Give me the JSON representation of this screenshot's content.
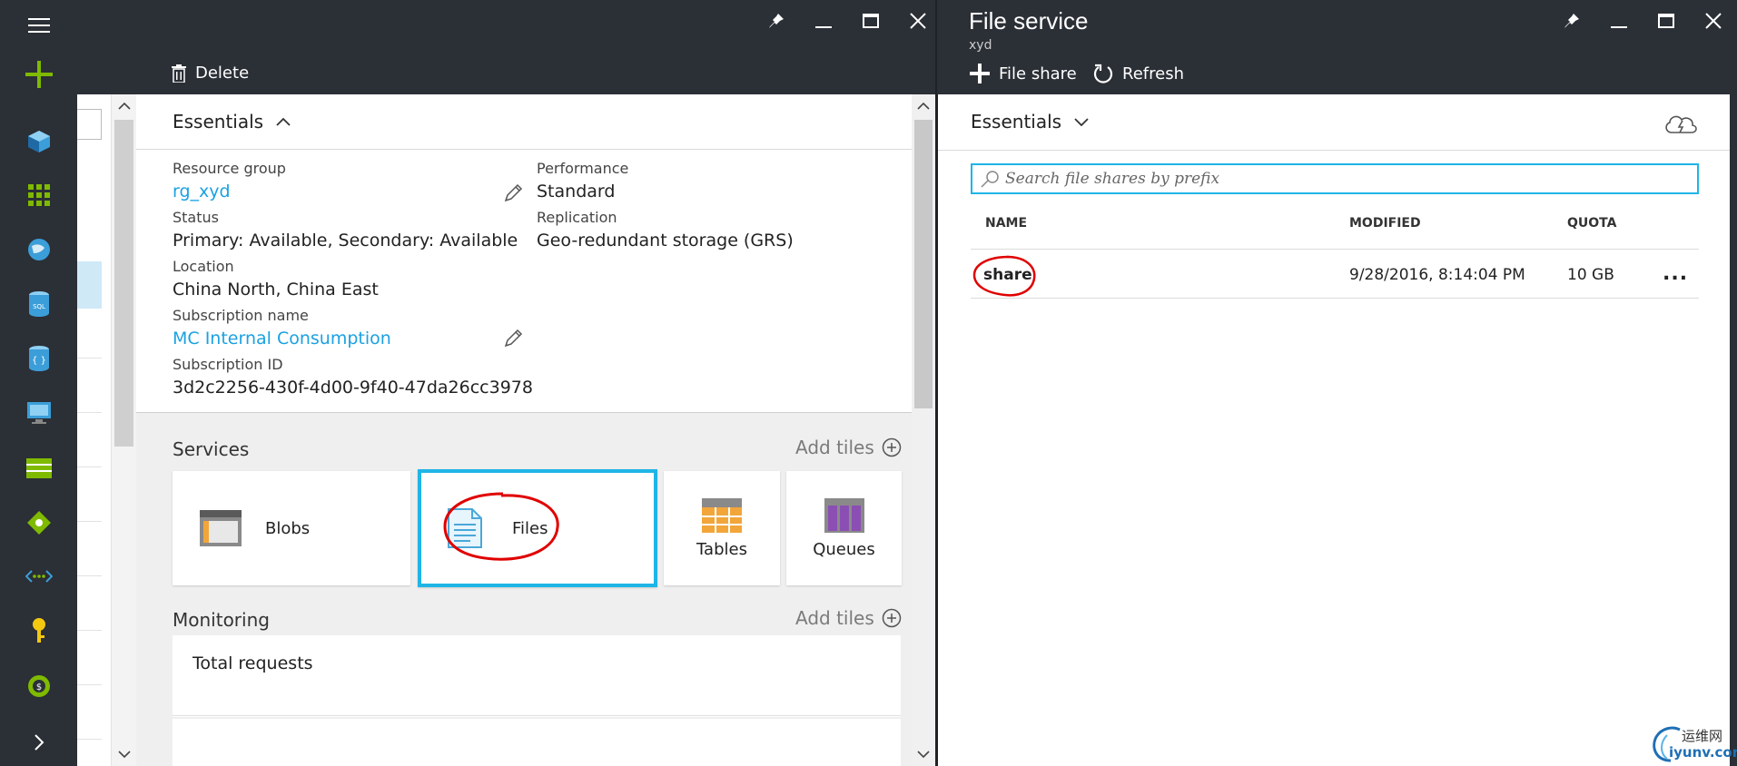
{
  "colors": {
    "chrome": "#2b2f36",
    "accent": "#1fb5e6",
    "link": "#1ba1e2",
    "annotation": "#e00000"
  },
  "nav": {
    "icons": [
      "hamburger-menu-icon",
      "new-plus-icon",
      "cube-icon",
      "grid-icon",
      "globe-icon",
      "sql-database-icon",
      "document-db-icon",
      "virtual-machine-icon",
      "storage-icon",
      "network-icon",
      "connections-icon",
      "key-icon",
      "billing-icon",
      "chevron-right-icon"
    ]
  },
  "left_blade": {
    "toolbar": {
      "delete_label": "Delete"
    },
    "essentials": {
      "heading": "Essentials",
      "resource_group_label": "Resource group",
      "resource_group_value": "rg_xyd",
      "status_label": "Status",
      "status_value": "Primary: Available, Secondary: Available",
      "location_label": "Location",
      "location_value": "China North, China East",
      "subscription_name_label": "Subscription name",
      "subscription_name_value": "MC Internal Consumption",
      "subscription_id_label": "Subscription ID",
      "subscription_id_value": "3d2c2256-430f-4d00-9f40-47da26cc3978",
      "performance_label": "Performance",
      "performance_value": "Standard",
      "replication_label": "Replication",
      "replication_value": "Geo-redundant storage (GRS)"
    },
    "services": {
      "title": "Services",
      "add_tiles": "Add tiles",
      "tiles": [
        {
          "label": "Blobs"
        },
        {
          "label": "Files"
        },
        {
          "label": "Tables"
        },
        {
          "label": "Queues"
        }
      ]
    },
    "monitoring": {
      "title": "Monitoring",
      "add_tiles": "Add tiles",
      "card_title": "Total requests"
    }
  },
  "right_blade": {
    "title": "File service",
    "subtitle": "xyd",
    "toolbar": {
      "file_share_label": "File share",
      "refresh_label": "Refresh"
    },
    "essentials_heading": "Essentials",
    "search": {
      "placeholder": "Search file shares by prefix",
      "value": ""
    },
    "table": {
      "headers": {
        "name": "NAME",
        "modified": "MODIFIED",
        "quota": "QUOTA"
      },
      "rows": [
        {
          "name": "share",
          "modified": "9/28/2016, 8:14:04 PM",
          "quota": "10 GB",
          "more": "..."
        }
      ]
    }
  },
  "watermark": {
    "cn": "运维网",
    "url": "iyunv.com"
  }
}
